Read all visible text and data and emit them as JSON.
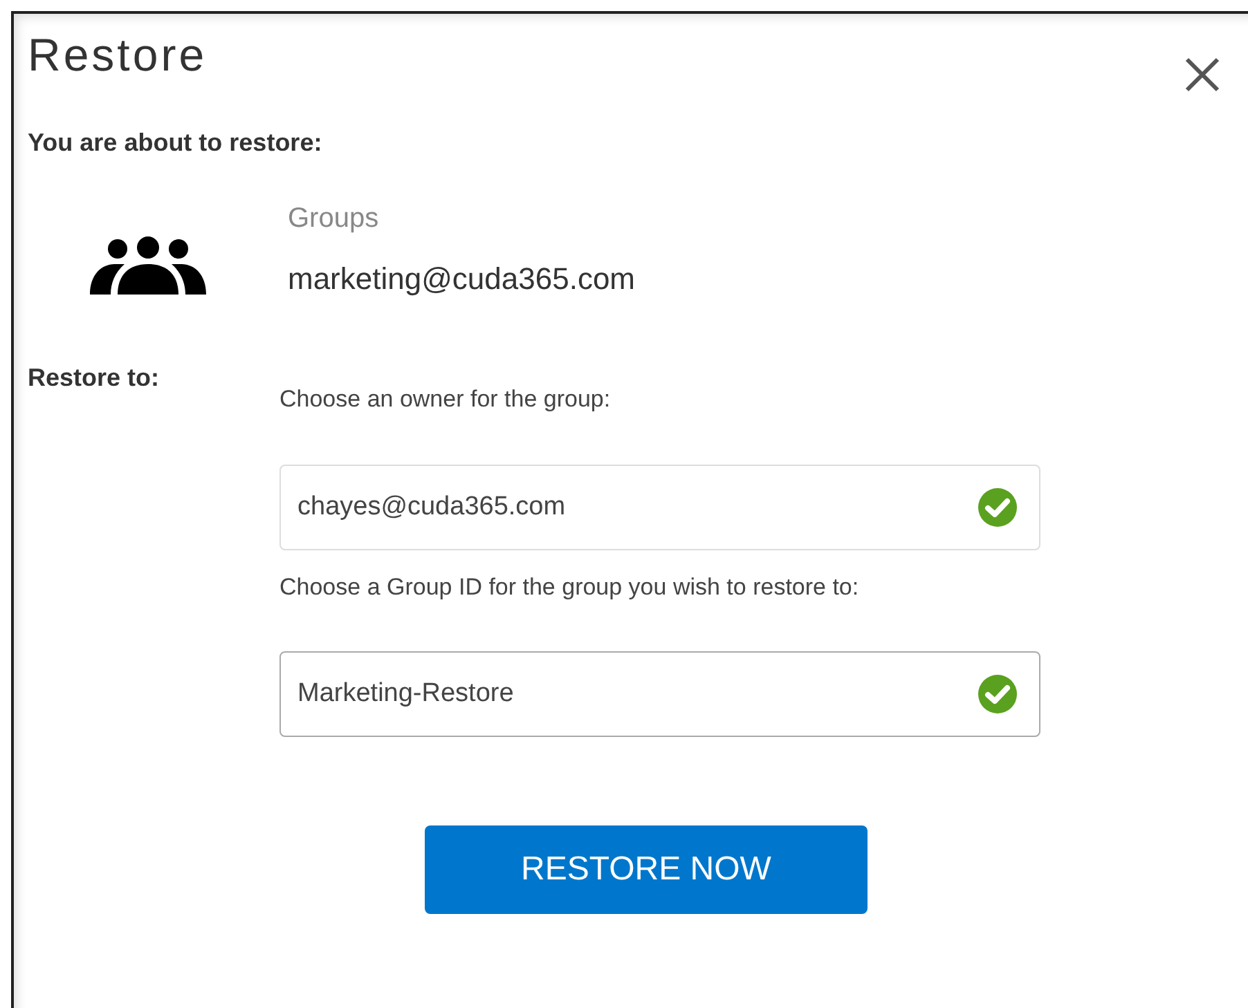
{
  "dialog": {
    "title": "Restore",
    "heading": "You are about to restore:"
  },
  "item": {
    "type": "Groups",
    "name": "marketing@cuda365.com"
  },
  "restore_to": {
    "label": "Restore to:",
    "fields": [
      {
        "label": "Choose an owner for the group:",
        "value": "chayes@cuda365.com",
        "valid": true,
        "focused": false
      },
      {
        "label": "Choose a Group ID for the group you wish to restore to:",
        "value": "Marketing-Restore",
        "valid": true,
        "focused": true
      }
    ]
  },
  "button": {
    "label": "RESTORE NOW"
  }
}
